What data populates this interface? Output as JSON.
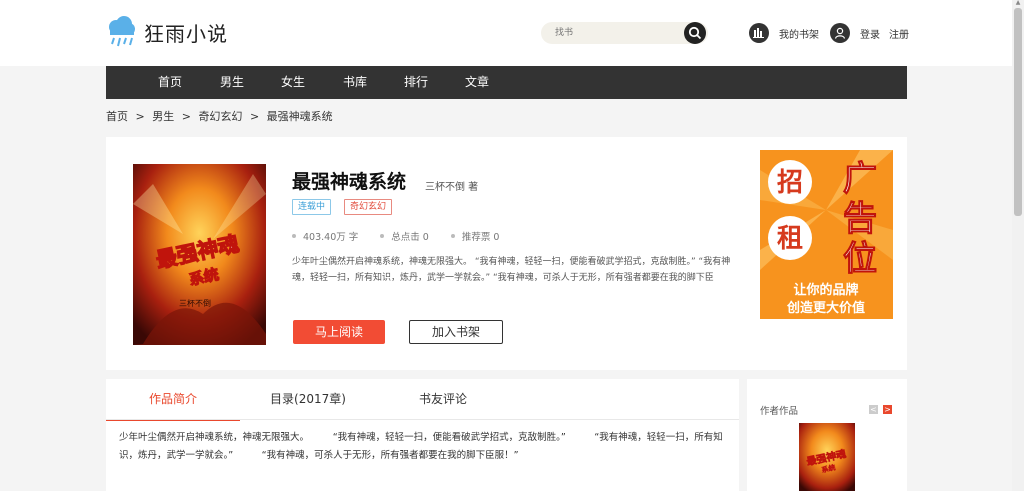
{
  "site": {
    "name": "狂雨小说"
  },
  "search": {
    "placeholder": "找书"
  },
  "user": {
    "shelf": "我的书架",
    "login": "登录",
    "register": "注册"
  },
  "nav": [
    "首页",
    "男生",
    "女生",
    "书库",
    "排行",
    "文章"
  ],
  "breadcrumb": [
    "首页",
    ">",
    "男生",
    ">",
    "奇幻玄幻",
    ">",
    "最强神魂系统"
  ],
  "book": {
    "title": "最强神魂系统",
    "author": "三杯不倒 著",
    "status": "连载中",
    "genre": "奇幻玄幻",
    "words": "403.40万 字",
    "clicks": "总点击 0",
    "votes": "推荐票 0",
    "intro": "少年叶尘偶然开启神魂系统，神魂无限强大。 “我有神魂，轻轻一扫，便能看破武学招式，克敌制胜。” “我有神魂，轻轻一扫，所有知识，炼丹，武学一学就会。” “我有神魂，可杀人于无形，所有强者都要在我的脚下臣服！”",
    "cover_title": "最强神魂",
    "cover_subtitle": "系统",
    "cover_author": "三杯不倒",
    "read_btn": "马上阅读",
    "shelf_btn": "加入书架"
  },
  "ad": {
    "c1": "招",
    "c2": "租",
    "c3": "广",
    "c4": "告",
    "c5": "位",
    "line1": "让你的品牌",
    "line2": "创造更大价值"
  },
  "tabs": [
    "作品简介",
    "目录(2017章)",
    "书友评论"
  ],
  "tab_content": "少年叶尘偶然开启神魂系统，神魂无限强大。　　　“我有神魂，轻轻一扫，便能看破武学招式，克敌制胜。”　　　“我有神魂，轻轻一扫，所有知识，炼丹，武学一学就会。”　　　“我有神魂，可杀人于无形，所有强者都要在我的脚下臣服！”",
  "sidebar": {
    "title": "作者作品",
    "prev": "<",
    "next": ">"
  },
  "colors": {
    "accent": "#f24c34",
    "nav_bg": "#333333",
    "status_tag": "#3ea0d8",
    "ad_bg": "#f7931e"
  }
}
